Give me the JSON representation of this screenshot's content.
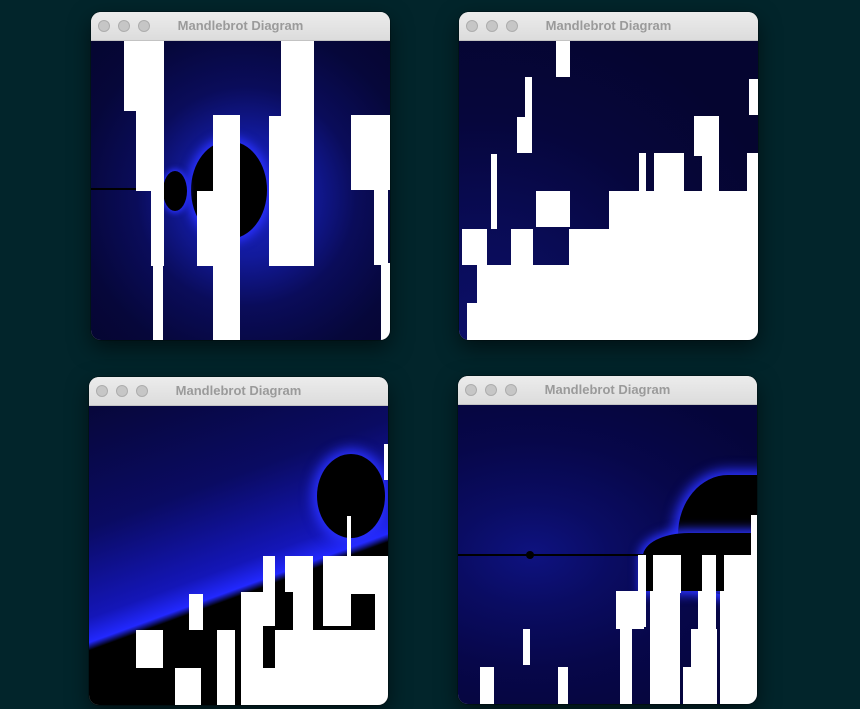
{
  "windows": [
    {
      "title": "Mandlebrot Diagram"
    },
    {
      "title": "Mandlebrot Diagram"
    },
    {
      "title": "Mandlebrot Diagram"
    },
    {
      "title": "Mandlebrot Diagram"
    }
  ],
  "colors": {
    "desktop": "#02252b",
    "fractal_deep": "#05052e",
    "fractal_edge": "#1b1fd8",
    "fractal_set": "#000000",
    "unrendered": "#ffffff"
  }
}
